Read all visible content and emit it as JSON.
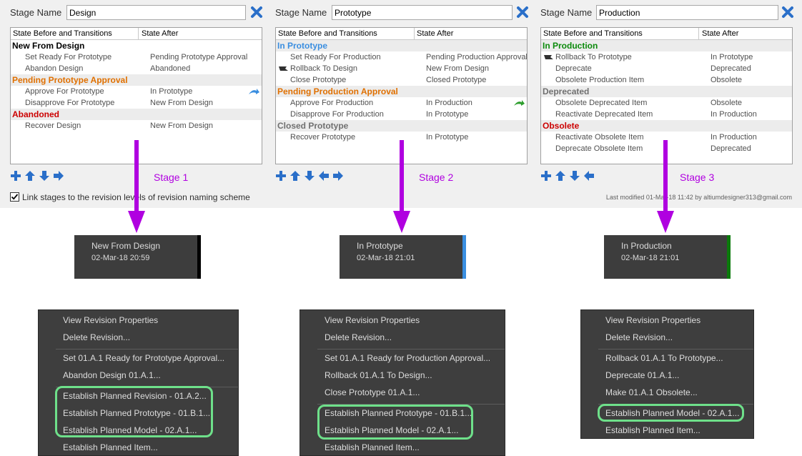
{
  "labels": {
    "stage_name": "Stage Name",
    "col_before": "State Before and Transitions",
    "col_after": "State After",
    "link_checkbox": "Link stages to the revision levels of revision naming scheme",
    "last_modified": "Last modified 01-Mar-18 11:42 by altiumdesigner313@gmail.com"
  },
  "colors": {
    "annotation_purple": "#b000e0",
    "highlight_green": "#6ee08a",
    "orange": "#e07000",
    "blue": "#3a8ee0",
    "red": "#cc0000",
    "green": "#0b8a0b",
    "gray": "#707070"
  },
  "stages": [
    {
      "name_value": "Design",
      "annotation": "Stage 1",
      "rows": [
        {
          "type": "group",
          "text": "New From Design",
          "color": "#000000"
        },
        {
          "type": "item",
          "before": "Set Ready For Prototype",
          "after": "Pending Prototype Approval"
        },
        {
          "type": "item",
          "before": "Abandon Design",
          "after": "Abandoned"
        },
        {
          "type": "group",
          "text": "Pending Prototype Approval",
          "color": "#e07000"
        },
        {
          "type": "item",
          "before": "Approve For Prototype",
          "after": "In Prototype",
          "right_icon": "forward-transition-icon"
        },
        {
          "type": "item",
          "before": "Disapprove For Prototype",
          "after": "New From Design"
        },
        {
          "type": "group",
          "text": "Abandoned",
          "color": "#cc0000"
        },
        {
          "type": "item",
          "before": "Recover Design",
          "after": "New From Design"
        }
      ],
      "toolbar": [
        "add-icon",
        "move-up-icon",
        "move-down-icon",
        "move-right-icon"
      ],
      "revision": {
        "state": "New From Design",
        "date": "02-Mar-18 20:59",
        "color": "#000000"
      },
      "menu": [
        {
          "text": "View Revision Properties"
        },
        {
          "text": "Delete Revision..."
        },
        {
          "sep": true
        },
        {
          "text": "Set 01.A.1 Ready for Prototype Approval..."
        },
        {
          "text": "Abandon Design 01.A.1..."
        },
        {
          "sep": true
        },
        {
          "text": "Establish Planned Revision - 01.A.2..."
        },
        {
          "text": "Establish Planned Prototype - 01.B.1..."
        },
        {
          "text": "Establish Planned Model - 02.A.1..."
        },
        {
          "text": "Establish Planned Item..."
        }
      ]
    },
    {
      "name_value": "Prototype",
      "annotation": "Stage 2",
      "rows": [
        {
          "type": "group",
          "text": "In Prototype",
          "color": "#3a8ee0"
        },
        {
          "type": "item",
          "before": "Set Ready For Production",
          "after": "Pending Production Approval"
        },
        {
          "type": "item",
          "before": "Rollback To Design",
          "after": "New From Design",
          "left_icon": "rollback-flag-icon"
        },
        {
          "type": "item",
          "before": "Close Prototype",
          "after": "Closed Prototype"
        },
        {
          "type": "group",
          "text": "Pending Production Approval",
          "color": "#e07000"
        },
        {
          "type": "item",
          "before": "Approve For Production",
          "after": "In Production",
          "right_icon": "forward-transition-icon"
        },
        {
          "type": "item",
          "before": "Disapprove For Production",
          "after": "In Prototype"
        },
        {
          "type": "group",
          "text": "Closed Prototype",
          "color": "#707070"
        },
        {
          "type": "item",
          "before": "Recover Prototype",
          "after": "In Prototype"
        }
      ],
      "toolbar": [
        "add-icon",
        "move-up-icon",
        "move-down-icon",
        "move-left-icon",
        "move-right-icon"
      ],
      "revision": {
        "state": "In Prototype",
        "date": "02-Mar-18 21:01",
        "color": "#3a8ee0"
      },
      "menu": [
        {
          "text": "View Revision Properties"
        },
        {
          "text": "Delete Revision..."
        },
        {
          "sep": true
        },
        {
          "text": "Set 01.A.1 Ready for Production Approval..."
        },
        {
          "text": "Rollback 01.A.1 To Design..."
        },
        {
          "text": "Close Prototype 01.A.1..."
        },
        {
          "sep": true
        },
        {
          "text": "Establish Planned Prototype - 01.B.1..."
        },
        {
          "text": "Establish Planned Model - 02.A.1..."
        },
        {
          "text": "Establish Planned Item..."
        }
      ]
    },
    {
      "name_value": "Production",
      "annotation": "Stage 3",
      "rows": [
        {
          "type": "group",
          "text": "In Production",
          "color": "#0b8a0b"
        },
        {
          "type": "item",
          "before": "Rollback To Prototype",
          "after": "In Prototype",
          "left_icon": "rollback-flag-icon"
        },
        {
          "type": "item",
          "before": "Deprecate",
          "after": "Deprecated"
        },
        {
          "type": "item",
          "before": "Obsolete Production Item",
          "after": "Obsolete"
        },
        {
          "type": "group",
          "text": "Deprecated",
          "color": "#707070"
        },
        {
          "type": "item",
          "before": "Obsolete Deprecated Item",
          "after": "Obsolete"
        },
        {
          "type": "item",
          "before": "Reactivate Deprecated Item",
          "after": "In Production"
        },
        {
          "type": "group",
          "text": "Obsolete",
          "color": "#cc0000"
        },
        {
          "type": "item",
          "before": "Reactivate Obsolete Item",
          "after": "In Production"
        },
        {
          "type": "item",
          "before": "Deprecate Obsolete Item",
          "after": "Deprecated"
        }
      ],
      "toolbar": [
        "add-icon",
        "move-up-icon",
        "move-down-icon",
        "move-left-icon"
      ],
      "revision": {
        "state": "In Production",
        "date": "02-Mar-18 21:01",
        "color": "#0b7a0b"
      },
      "menu": [
        {
          "text": "View Revision Properties"
        },
        {
          "text": "Delete Revision..."
        },
        {
          "sep": true
        },
        {
          "text": "Rollback 01.A.1 To Prototype..."
        },
        {
          "text": "Deprecate 01.A.1..."
        },
        {
          "text": "Make 01.A.1 Obsolete..."
        },
        {
          "sep": true
        },
        {
          "text": "Establish Planned Model - 02.A.1..."
        },
        {
          "text": "Establish Planned Item..."
        }
      ]
    }
  ]
}
